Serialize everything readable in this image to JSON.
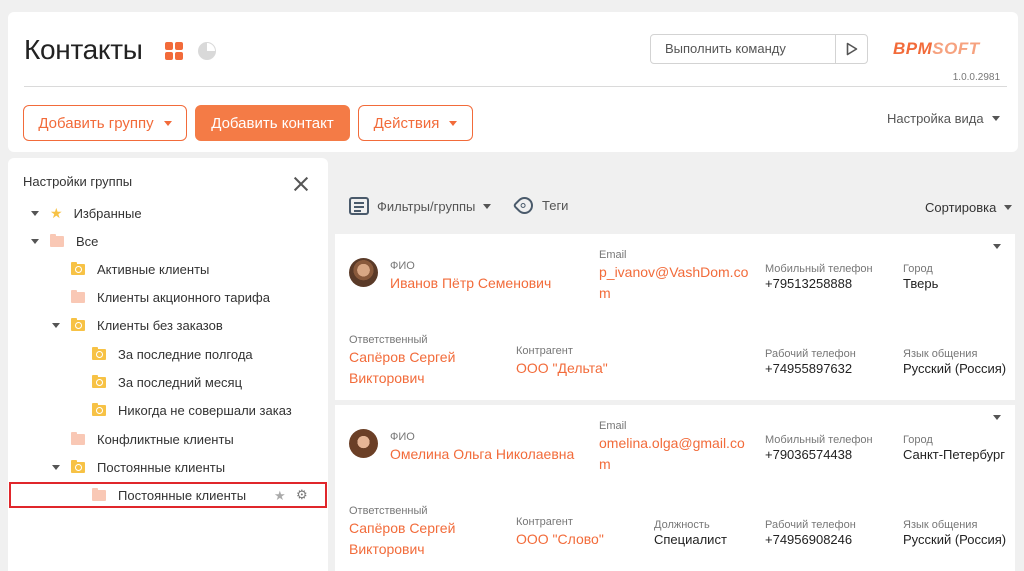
{
  "header": {
    "title": "Контакты",
    "command_placeholder": "Выполнить команду",
    "logo_part1": "BPM",
    "logo_part2": "SOFT",
    "version": "1.0.0.2981",
    "add_group_label": "Добавить группу",
    "add_contact_label": "Добавить контакт",
    "actions_label": "Действия",
    "view_settings_label": "Настройка вида",
    "accent_color": "#f26b3a"
  },
  "group_panel": {
    "title": "Настройки группы",
    "items": [
      {
        "label": "Избранные",
        "icon": "star-icon"
      },
      {
        "label": "Все",
        "icon": "folder-icon"
      },
      {
        "label": "Активные клиенты",
        "icon": "dynamic-folder-icon"
      },
      {
        "label": "Клиенты акционного тарифа",
        "icon": "folder-icon"
      },
      {
        "label": "Клиенты без заказов",
        "icon": "dynamic-folder-icon"
      },
      {
        "label": "За последние полгода",
        "icon": "dynamic-folder-icon"
      },
      {
        "label": "За последний месяц",
        "icon": "dynamic-folder-icon"
      },
      {
        "label": "Никогда не совершали заказ",
        "icon": "dynamic-folder-icon"
      },
      {
        "label": "Конфликтные клиенты",
        "icon": "folder-icon"
      },
      {
        "label": "Постоянные клиенты",
        "icon": "dynamic-folder-icon"
      },
      {
        "label": "Постоянные клиенты",
        "icon": "folder-icon",
        "selected": true
      }
    ]
  },
  "toolbar": {
    "filters_label": "Фильтры/группы",
    "tags_label": "Теги",
    "sort_label": "Сортировка"
  },
  "contacts": [
    {
      "name_label": "ФИО",
      "name": "Иванов Пётр Семенович",
      "email_label": "Email",
      "email_line1": "p_ivanov@VashDom.co",
      "email_line2": "m",
      "mobile_label": "Мобильный телефон",
      "mobile": "+79513258888",
      "city_label": "Город",
      "city": "Тверь",
      "owner_label": "Ответственный",
      "owner_line1": "Сапёров Сергей",
      "owner_line2": "Викторович",
      "account_label": "Контрагент",
      "account": "ООО \"Дельта\"",
      "work_phone_label": "Рабочий телефон",
      "work_phone": "+74955897632",
      "language_label": "Язык общения",
      "language": "Русский (Россия)"
    },
    {
      "name_label": "ФИО",
      "name": "Омелина Ольга Николаевна",
      "email_label": "Email",
      "email_line1": "omelina.olga@gmail.co",
      "email_line2": "m",
      "mobile_label": "Мобильный телефон",
      "mobile": "+79036574438",
      "city_label": "Город",
      "city": "Санкт-Петербург",
      "owner_label": "Ответственный",
      "owner_line1": "Сапёров Сергей",
      "owner_line2": "Викторович",
      "account_label": "Контрагент",
      "account": "ООО \"Слово\"",
      "job_label": "Должность",
      "job": "Специалист",
      "work_phone_label": "Рабочий телефон",
      "work_phone": "+74956908246",
      "language_label": "Язык общения",
      "language": "Русский (Россия)"
    }
  ]
}
